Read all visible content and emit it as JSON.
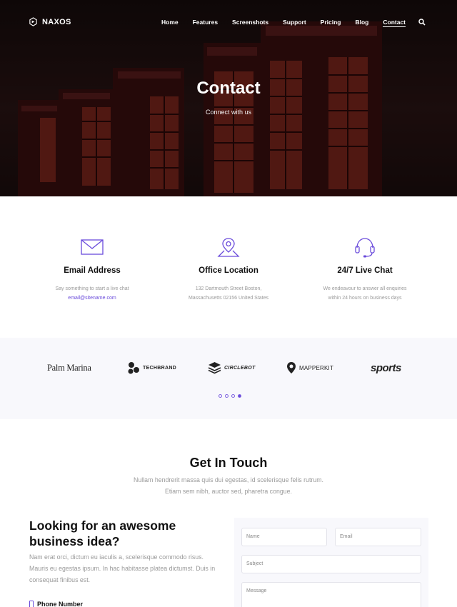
{
  "nav": {
    "brand": "NAXOS",
    "items": [
      "Home",
      "Features",
      "Screenshots",
      "Support",
      "Pricing",
      "Blog",
      "Contact"
    ],
    "active": "Contact"
  },
  "hero": {
    "title": "Contact",
    "subtitle": "Connect with us"
  },
  "info": [
    {
      "icon": "envelope-icon",
      "title": "Email Address",
      "line1": "Say something to start a live chat",
      "line2": "email@sitename.com"
    },
    {
      "icon": "map-pin-icon",
      "title": "Office Location",
      "line1": "132 Dartmouth Street Boston,",
      "line2": "Massachusetts 02156 United States"
    },
    {
      "icon": "headset-icon",
      "title": "24/7 Live Chat",
      "line1": "We endeavour to answer all enquiries",
      "line2": "within 24 hours on business days"
    }
  ],
  "brands": [
    "Palm Marina",
    "TECHBRAND",
    "CIRCLEBOT",
    "MAPPERKIT",
    "sports"
  ],
  "touch": {
    "title": "Get In Touch",
    "line1": "Nullam hendrerit massa quis dui egestas, id scelerisque felis rutrum.",
    "line2": "Etiam sem nibh, auctor sed, pharetra congue."
  },
  "left": {
    "heading": "Looking for an awesome business idea?",
    "text": "Nam erat orci, dictum eu iaculis a, scelerisque commodo risus. Mauris eu egestas ipsum. In hac habitasse platea dictumst. Duis in consequat finibus est.",
    "phone_label": "Phone Number"
  },
  "form": {
    "name_placeholder": "Name",
    "email_placeholder": "Email",
    "subject_placeholder": "Subject",
    "message_placeholder": "Message"
  },
  "colors": {
    "accent": "#6a4bdb"
  }
}
